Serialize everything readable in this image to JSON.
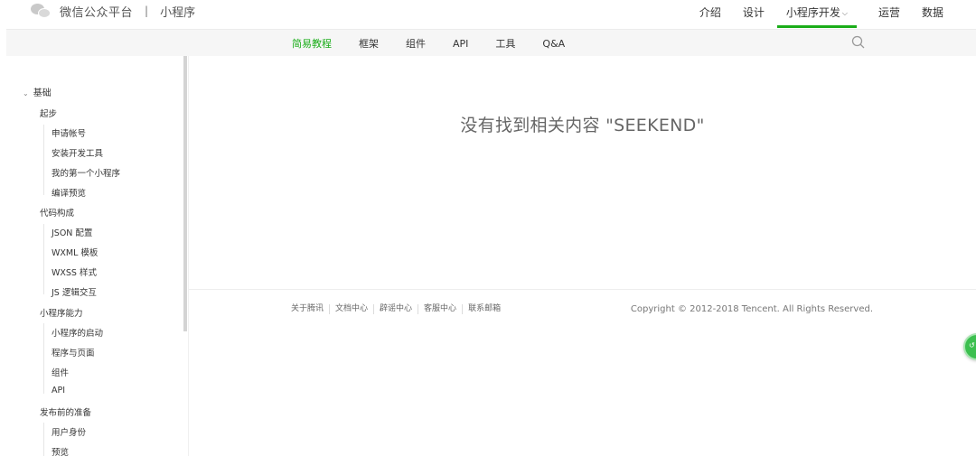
{
  "header": {
    "brand_name": "微信公众平台",
    "separator": "|",
    "product": "小程序",
    "nav": [
      {
        "label": "介绍"
      },
      {
        "label": "设计"
      },
      {
        "label": "小程序开发",
        "active": true
      },
      {
        "label": "运营"
      },
      {
        "label": "数据"
      }
    ]
  },
  "subnav": {
    "items": [
      {
        "label": "简易教程",
        "active": true
      },
      {
        "label": "框架"
      },
      {
        "label": "组件"
      },
      {
        "label": "API"
      },
      {
        "label": "工具"
      },
      {
        "label": "Q&A"
      }
    ],
    "search_icon": "search-icon"
  },
  "sidebar": {
    "items": [
      {
        "label": "基础",
        "level": 1
      },
      {
        "label": "起步",
        "level": 2
      },
      {
        "label": "申请帐号",
        "level": 3
      },
      {
        "label": "安装开发工具",
        "level": 3
      },
      {
        "label": "我的第一个小程序",
        "level": 3
      },
      {
        "label": "编译预览",
        "level": 3
      },
      {
        "label": "代码构成",
        "level": 2
      },
      {
        "label": "JSON 配置",
        "level": 3
      },
      {
        "label": "WXML 模板",
        "level": 3
      },
      {
        "label": "WXSS 样式",
        "level": 3
      },
      {
        "label": "JS 逻辑交互",
        "level": 3
      },
      {
        "label": "小程序能力",
        "level": 2
      },
      {
        "label": "小程序的启动",
        "level": 3
      },
      {
        "label": "程序与页面",
        "level": 3
      },
      {
        "label": "组件",
        "level": 3
      },
      {
        "label": "API",
        "level": 3
      },
      {
        "label": "发布前的准备",
        "level": 2
      },
      {
        "label": "用户身份",
        "level": 3
      },
      {
        "label": "预览",
        "level": 3
      }
    ]
  },
  "main": {
    "empty_message": "没有找到相关内容 \"SEEKEND\""
  },
  "footer": {
    "links": [
      {
        "label": "关于腾讯"
      },
      {
        "label": "文档中心"
      },
      {
        "label": "辟谣中心"
      },
      {
        "label": "客服中心"
      },
      {
        "label": "联系邮箱"
      }
    ],
    "copyright": "Copyright © 2012-2018 Tencent. All Rights Reserved."
  },
  "colors": {
    "accent": "#1aad19",
    "subnav_bg": "#f6f6f6",
    "text": "#353535"
  }
}
